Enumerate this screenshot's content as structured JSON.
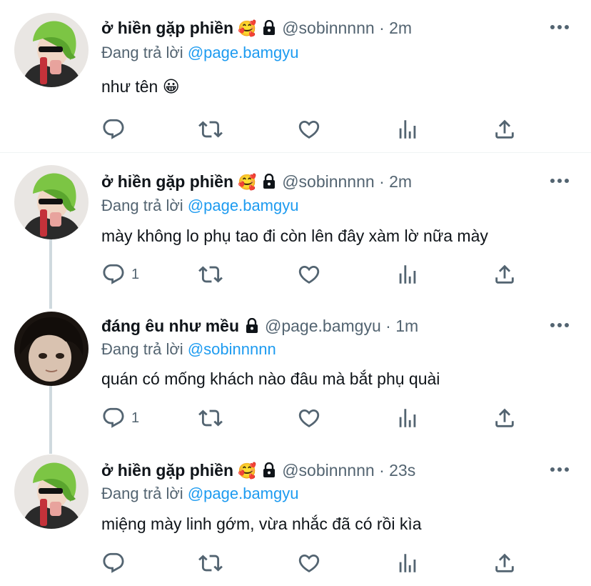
{
  "colors": {
    "accent": "#1d9bf0",
    "muted": "#536471",
    "text": "#0f1419",
    "line": "#cfd9de"
  },
  "reply_prefix": "Đang trả lời",
  "tweets": [
    {
      "name": "ở hiền gặp phiền",
      "name_emoji": "🥰",
      "handle": "@sobinnnnn",
      "separator": "·",
      "time": "2m",
      "reply_to": "@page.bamgyu",
      "text": "như tên 😀",
      "reply_count": "",
      "avatar": "green-hat-girl"
    },
    {
      "name": "ở hiền gặp phiền",
      "name_emoji": "🥰",
      "handle": "@sobinnnnn",
      "separator": "·",
      "time": "2m",
      "reply_to": "@page.bamgyu",
      "text": "mày không lo phụ tao đi còn lên đây xàm lờ nữa mày",
      "reply_count": "1",
      "avatar": "green-hat-girl"
    },
    {
      "name": "đáng êu như mều",
      "name_emoji": "",
      "handle": "@page.bamgyu",
      "separator": "·",
      "time": "1m",
      "reply_to": "@sobinnnnn",
      "text": "quán có mống khách nào đâu mà bắt phụ quài",
      "reply_count": "1",
      "avatar": "dark-hair-boy"
    },
    {
      "name": "ở hiền gặp phiền",
      "name_emoji": "🥰",
      "handle": "@sobinnnnn",
      "separator": "·",
      "time": "23s",
      "reply_to": "@page.bamgyu",
      "text": "miệng mày linh gớm, vừa nhắc đã có rồi kìa",
      "reply_count": "",
      "avatar": "green-hat-girl"
    }
  ]
}
